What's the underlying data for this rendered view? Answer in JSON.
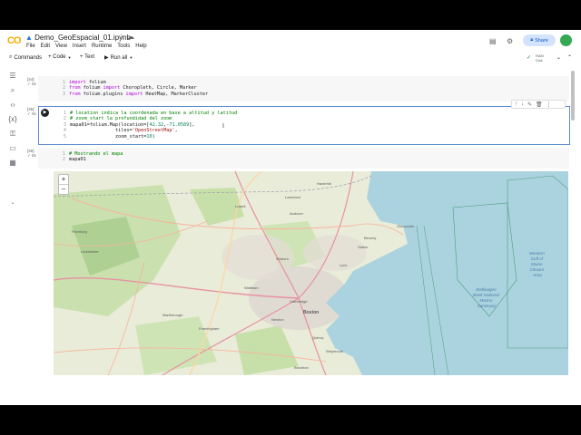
{
  "header": {
    "logo": "CO",
    "notebook_title": "Demo_GeoEspacial_01.ipynb",
    "menu": [
      "File",
      "Edit",
      "View",
      "Insert",
      "Runtime",
      "Tools",
      "Help"
    ],
    "share_label": "Share"
  },
  "toolbar": {
    "commands": "Commands",
    "add_code": "+ Code",
    "add_text": "+ Text",
    "run_all": "Run all",
    "ram_label": "RAM",
    "disk_label": "Disk"
  },
  "cells": [
    {
      "exec_count": "[44]",
      "exec_time": "0s",
      "lines": [
        {
          "n": "1",
          "parts": [
            [
              "kw",
              "import"
            ],
            [
              "",
              " folium"
            ]
          ]
        },
        {
          "n": "2",
          "parts": [
            [
              "kw",
              "from"
            ],
            [
              "",
              " folium "
            ],
            [
              "kw",
              "import"
            ],
            [
              "",
              " Choropleth, Circle, Marker"
            ]
          ]
        },
        {
          "n": "3",
          "parts": [
            [
              "kw",
              "from"
            ],
            [
              "",
              " folium.plugins "
            ],
            [
              "kw",
              "import"
            ],
            [
              "",
              " HeatMap, MarkerCluster"
            ]
          ]
        }
      ]
    },
    {
      "exec_count": "[45]",
      "exec_time": "0s",
      "lines": [
        {
          "n": "1",
          "parts": [
            [
              "cm",
              "# location indica la coordenada en base a altitud y latitud"
            ]
          ]
        },
        {
          "n": "2",
          "parts": [
            [
              "cm",
              "# zoom_start la profundidad del zoom"
            ]
          ]
        },
        {
          "n": "3",
          "parts": [
            [
              "",
              "mapa01=folium.Map(location=["
            ],
            [
              "num",
              "42.32"
            ],
            [
              "",
              ",-"
            ],
            [
              "num",
              "71.0589"
            ],
            [
              "",
              "],"
            ]
          ]
        },
        {
          "n": "4",
          "parts": [
            [
              "",
              "                tiles="
            ],
            [
              "st",
              "'OpenStreetMap'"
            ],
            [
              "",
              ","
            ]
          ]
        },
        {
          "n": "5",
          "parts": [
            [
              "",
              "                zoom_start="
            ],
            [
              "num",
              "10"
            ],
            [
              "",
              ")"
            ]
          ]
        }
      ]
    },
    {
      "exec_count": "[46]",
      "exec_time": "0s",
      "lines": [
        {
          "n": "1",
          "parts": [
            [
              "cm",
              "# Mostrando el mapa"
            ]
          ]
        },
        {
          "n": "2",
          "parts": [
            [
              "",
              "mapa01"
            ]
          ]
        }
      ]
    }
  ],
  "map": {
    "zoom_in": "+",
    "zoom_out": "−",
    "places": [
      {
        "name": "Lowell"
      },
      {
        "name": "Lawrence"
      },
      {
        "name": "Haverhill"
      },
      {
        "name": "Andover"
      },
      {
        "name": "Fitchburg"
      },
      {
        "name": "Leominster"
      },
      {
        "name": "Woburn"
      },
      {
        "name": "Lynn"
      },
      {
        "name": "Salem"
      },
      {
        "name": "Beverly"
      },
      {
        "name": "Gloucester"
      },
      {
        "name": "Boston"
      },
      {
        "name": "Cambridge"
      },
      {
        "name": "Waltham"
      },
      {
        "name": "Newton"
      },
      {
        "name": "Framingham"
      },
      {
        "name": "Quincy"
      },
      {
        "name": "Weymouth"
      },
      {
        "name": "Brockton"
      },
      {
        "name": "Marlborough"
      }
    ],
    "sea_labels": [
      {
        "text": [
          "Stellwagen",
          "Bank National",
          "Marine",
          "Sanctuary"
        ]
      },
      {
        "text": [
          "Western",
          "Gulf of",
          "Maine",
          "Closure",
          "Area"
        ]
      }
    ]
  }
}
